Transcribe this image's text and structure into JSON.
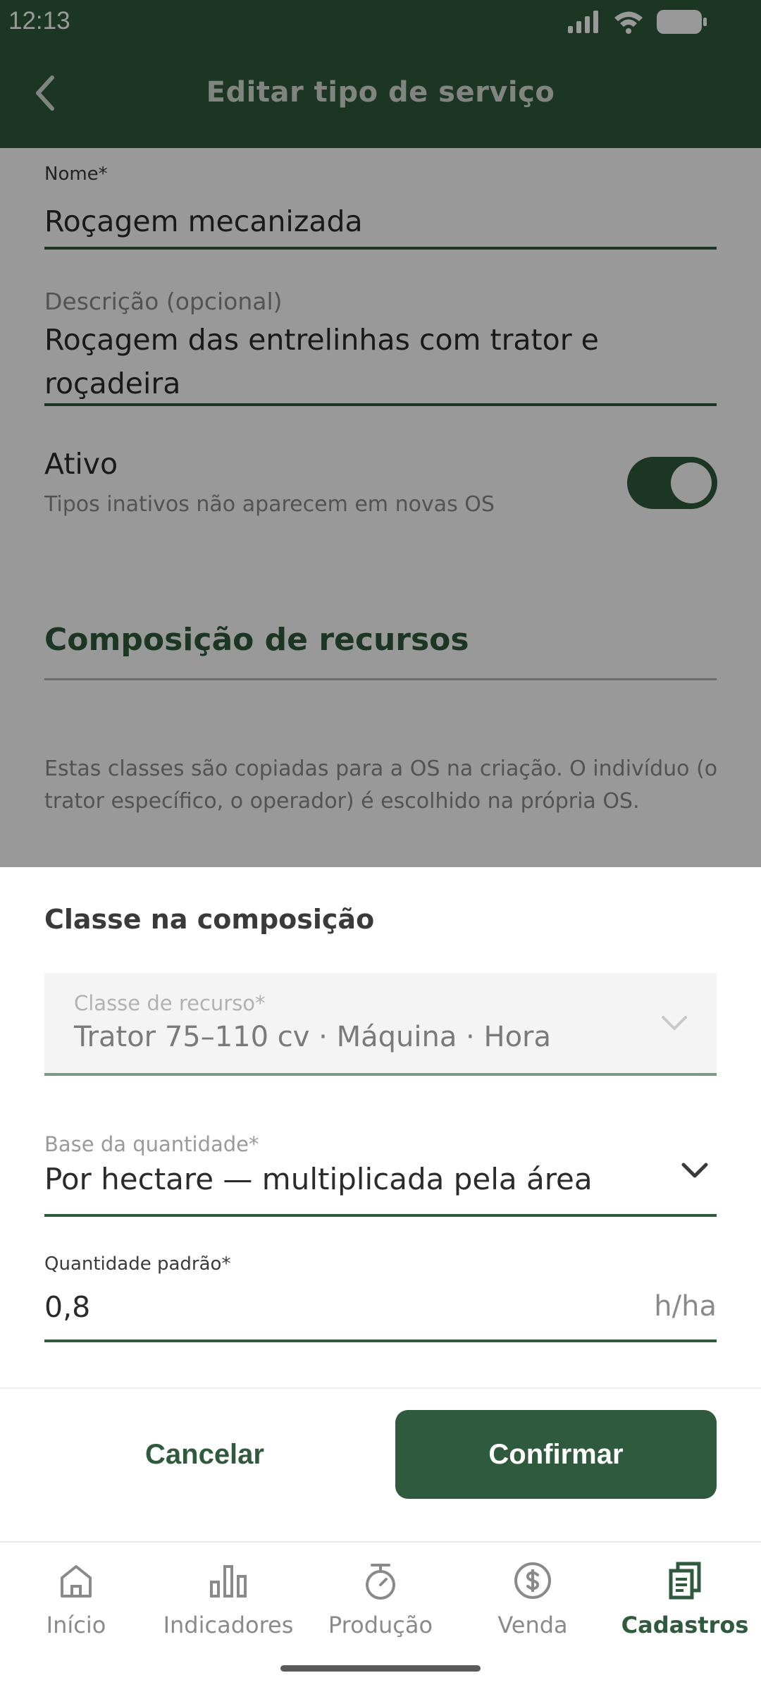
{
  "status_bar": {
    "time": "12:13",
    "icons": [
      "signal-icon",
      "wifi-icon",
      "battery-icon"
    ]
  },
  "app_bar": {
    "title": "Editar tipo de serviço",
    "back_icon": "chevron-left-icon"
  },
  "form": {
    "name": {
      "label": "Nome*",
      "value": "Roçagem mecanizada"
    },
    "description": {
      "label": "Descrição (opcional)",
      "value_line1": "Roçagem das entrelinhas com trator e",
      "value_line2": "roçadeira"
    },
    "active": {
      "label": "Ativo",
      "hint": "Tipos inativos não aparecem em novas OS",
      "on": true
    },
    "section_title": "Composição de recursos",
    "section_hint": "Estas classes são copiadas para a OS na criação. O indivíduo (o trator específico, o operador) é escolhido na própria OS."
  },
  "sheet": {
    "title": "Classe na composição",
    "resource_class": {
      "label": "Classe de recurso*",
      "value": "Trator 75–110 cv · Máquina · Hora"
    },
    "quantity_base": {
      "label": "Base da quantidade*",
      "value": "Por hectare — multiplicada pela área"
    },
    "default_quantity": {
      "label": "Quantidade padrão*",
      "value": "0,8",
      "unit": "h/ha"
    },
    "cancel_label": "Cancelar",
    "confirm_label": "Confirmar"
  },
  "nav": {
    "items": [
      {
        "label": "Início",
        "icon": "home-icon",
        "active": false
      },
      {
        "label": "Indicadores",
        "icon": "bar-chart-icon",
        "active": false
      },
      {
        "label": "Produção",
        "icon": "scale-icon",
        "active": false
      },
      {
        "label": "Venda",
        "icon": "dollar-icon",
        "active": false
      },
      {
        "label": "Cadastros",
        "icon": "documents-icon",
        "active": true
      }
    ]
  },
  "colors": {
    "primary": "#2f5a3d",
    "scrim": "rgba(0,0,0,0.40)"
  }
}
